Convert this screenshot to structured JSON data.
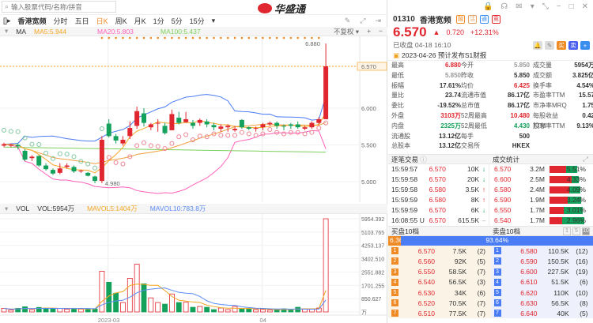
{
  "search": {
    "placeholder": "输入股票代码/名称/拼音"
  },
  "logo": "华盛通",
  "toolbar": {
    "stock": "香港宽频",
    "tabs": [
      "分时",
      "五日",
      "日K",
      "周K",
      "月K",
      "1分",
      "5分",
      "15分"
    ],
    "active": "日K"
  },
  "ma_legend": {
    "label": "MA",
    "ma5": "MA5:5.944",
    "ma20": "MA20:5.803",
    "ma100": "MA100:5.437",
    "adjust": "不复权"
  },
  "vol_legend": {
    "label": "VOL",
    "vol": "VOL:5954万",
    "mavol5": "MAVOL5:1404万",
    "mavol10": "MAVOL10:783.8万"
  },
  "price_axis": [
    "6.570",
    "6.000",
    "5.500",
    "5.000"
  ],
  "annotations": {
    "high": "6.880",
    "low": "4.980"
  },
  "vol_axis": [
    "5954.392",
    "5103.765",
    "4253.137",
    "3402.510",
    "2551.882",
    "1701.255",
    "850.627",
    "万"
  ],
  "date_axis": [
    "2023-03",
    "04"
  ],
  "colors": {
    "up": "#e0262e",
    "down": "#13a15b",
    "ma5": "#f5a623",
    "ma20": "#ff5fb8",
    "ma100": "#7ccf5a",
    "boll_up": "#4a7cf5",
    "mavol10": "#5b8cf5"
  },
  "candles": [
    [
      5.49,
      5.53,
      5.47,
      5.51
    ],
    [
      5.5,
      5.52,
      5.47,
      5.5
    ],
    [
      5.5,
      5.52,
      5.44,
      5.48
    ],
    [
      5.42,
      5.44,
      5.28,
      5.3
    ],
    [
      5.32,
      5.36,
      5.28,
      5.34
    ],
    [
      5.35,
      5.36,
      5.2,
      5.22
    ],
    [
      5.22,
      5.25,
      5.15,
      5.17
    ],
    [
      5.16,
      5.18,
      5.09,
      5.11
    ],
    [
      5.12,
      5.25,
      5.1,
      5.18
    ],
    [
      5.2,
      5.25,
      5.18,
      5.22
    ],
    [
      5.2,
      5.22,
      5.12,
      5.14
    ],
    [
      5.14,
      5.16,
      5.12,
      5.15
    ],
    [
      5.12,
      5.13,
      5.07,
      5.08
    ],
    [
      5.07,
      5.08,
      4.98,
      5.01
    ],
    [
      5.01,
      5.62,
      4.98,
      5.57
    ],
    [
      5.79,
      5.85,
      5.6,
      5.62
    ],
    [
      5.62,
      5.65,
      5.52,
      5.56
    ],
    [
      5.52,
      5.62,
      5.49,
      5.57
    ],
    [
      5.62,
      5.82,
      5.58,
      5.73
    ],
    [
      5.76,
      6.02,
      5.72,
      5.96
    ],
    [
      5.93,
      6.0,
      5.75,
      5.8
    ],
    [
      5.74,
      5.8,
      5.7,
      5.78
    ],
    [
      5.79,
      5.85,
      5.68,
      5.8
    ],
    [
      5.76,
      5.8,
      5.64,
      5.66
    ],
    [
      5.7,
      5.98,
      5.7,
      5.92
    ],
    [
      5.87,
      5.95,
      5.78,
      5.8
    ],
    [
      5.81,
      5.95,
      5.8,
      5.85
    ],
    [
      5.8,
      5.84,
      5.72,
      5.76
    ],
    [
      5.8,
      5.86,
      5.76,
      5.84
    ],
    [
      5.82,
      5.85,
      5.74,
      5.78
    ],
    [
      5.77,
      5.8,
      5.7,
      5.74
    ],
    [
      5.72,
      5.78,
      5.68,
      5.75
    ],
    [
      5.74,
      5.78,
      5.68,
      5.76
    ],
    [
      5.7,
      5.76,
      5.68,
      5.72
    ],
    [
      5.84,
      5.85,
      5.72,
      5.74
    ],
    [
      5.74,
      5.75,
      5.7,
      5.72
    ],
    [
      5.72,
      5.75,
      5.68,
      5.73
    ],
    [
      5.74,
      5.8,
      5.7,
      5.78
    ],
    [
      5.78,
      5.82,
      5.76,
      5.8
    ],
    [
      5.8,
      5.82,
      5.72,
      5.76
    ],
    [
      5.76,
      5.78,
      5.7,
      5.75
    ],
    [
      5.78,
      5.8,
      5.72,
      5.76
    ],
    [
      5.78,
      5.82,
      5.72,
      5.74
    ],
    [
      5.72,
      5.76,
      5.7,
      5.74
    ],
    [
      5.74,
      5.82,
      5.72,
      5.8
    ],
    [
      5.8,
      5.88,
      5.78,
      5.85
    ],
    [
      5.85,
      6.88,
      5.85,
      6.57
    ]
  ],
  "volumes": [
    230,
    130,
    230,
    330,
    150,
    290,
    250,
    200,
    230,
    180,
    200,
    180,
    200,
    200,
    2600,
    1900,
    1200,
    600,
    2150,
    3050,
    1800,
    900,
    600,
    500,
    1150,
    600,
    620,
    300,
    350,
    300,
    150,
    250,
    150,
    350,
    200,
    180,
    150,
    160,
    120,
    160,
    200,
    120,
    300,
    200,
    180,
    250,
    5954
  ],
  "quote": {
    "code": "01310",
    "name": "香港宽频",
    "tags": [
      "融",
      "沽",
      "通",
      "竞"
    ],
    "price": "6.570",
    "change": "0.720",
    "pct": "+12.31%",
    "status": "已收盘 04-18 16:10",
    "btn_buy": "买",
    "btn_sell": "卖",
    "btn_add": "+",
    "notice": "2023-04-26 预计发布S1财报"
  },
  "stats": [
    [
      "最高",
      "6.880",
      "今开",
      "5.850",
      "成交量",
      "5954万"
    ],
    [
      "最低",
      "5.850",
      "昨收",
      "5.850",
      "成交额",
      "3.825亿"
    ],
    [
      "振幅",
      "17.61%",
      "均价",
      "6.425",
      "换手率",
      "4.54%"
    ],
    [
      "量比",
      "23.74",
      "流通市值",
      "86.17亿",
      "市盈率TTM",
      "15.57"
    ],
    [
      "委比",
      "-19.52%",
      "总市值",
      "86.17亿",
      "市净率MRQ",
      "1.75"
    ],
    [
      "外盘",
      "3103万",
      "52周最高",
      "10.480",
      "每股收益TTM",
      "0.42"
    ],
    [
      "内盘",
      "2325万",
      "52周最低",
      "4.430",
      "股息率TTM",
      "9.13%"
    ],
    [
      "流通股",
      "13.12亿",
      "每手",
      "500",
      "",
      ""
    ],
    [
      "总股本",
      "13.12亿",
      "交易所",
      "HKEX",
      "",
      ""
    ]
  ],
  "trades_title": "逐笔交易",
  "stats_title": "成交统计",
  "trades": [
    [
      "15:59:57",
      "",
      "6.570",
      "10K",
      "down"
    ],
    [
      "15:59:58",
      "",
      "6.570",
      "20K",
      "down"
    ],
    [
      "15:59:58",
      "",
      "6.580",
      "3.5K",
      "up"
    ],
    [
      "15:59:59",
      "",
      "6.580",
      "8K",
      "up"
    ],
    [
      "15:59:59",
      "",
      "6.570",
      "6K",
      "down"
    ],
    [
      "16:08:55",
      "U",
      "6.570",
      "615.5K",
      "flat"
    ]
  ],
  "volstats": [
    [
      "6.570",
      "3.2M",
      "5.51%",
      0.45
    ],
    [
      "6.600",
      "2.5M",
      "4.33%",
      0.6
    ],
    [
      "6.580",
      "2.4M",
      "4.09%",
      0.55
    ],
    [
      "6.590",
      "1.9M",
      "3.24%",
      0.5
    ],
    [
      "6.550",
      "1.7M",
      "3.01%",
      0.4
    ],
    [
      "6.540",
      "1.7M",
      "2.96%",
      0.35
    ]
  ],
  "book_bid_title": "买盘10档",
  "book_ask_title": "卖盘10档",
  "levels": [
    "1",
    "5",
    "10"
  ],
  "bid_pct": "6.36%",
  "ask_pct": "93.64%",
  "bids": [
    [
      "1",
      "6.570",
      "7.5K",
      "(2)"
    ],
    [
      "2",
      "6.560",
      "92K",
      "(5)"
    ],
    [
      "3",
      "6.550",
      "58.5K",
      "(7)"
    ],
    [
      "4",
      "6.540",
      "56.5K",
      "(3)"
    ],
    [
      "5",
      "6.530",
      "34K",
      "(6)"
    ],
    [
      "6",
      "6.520",
      "70.5K",
      "(7)"
    ],
    [
      "7",
      "6.510",
      "77.5K",
      "(7)"
    ]
  ],
  "asks": [
    [
      "1",
      "6.580",
      "110.5K",
      "(12)"
    ],
    [
      "2",
      "6.590",
      "150.5K",
      "(16)"
    ],
    [
      "3",
      "6.600",
      "227.5K",
      "(19)"
    ],
    [
      "4",
      "6.610",
      "51.5K",
      "(6)"
    ],
    [
      "5",
      "6.620",
      "110K",
      "(10)"
    ],
    [
      "6",
      "6.630",
      "56.5K",
      "(8)"
    ],
    [
      "7",
      "6.640",
      "40K",
      "(5)"
    ]
  ]
}
